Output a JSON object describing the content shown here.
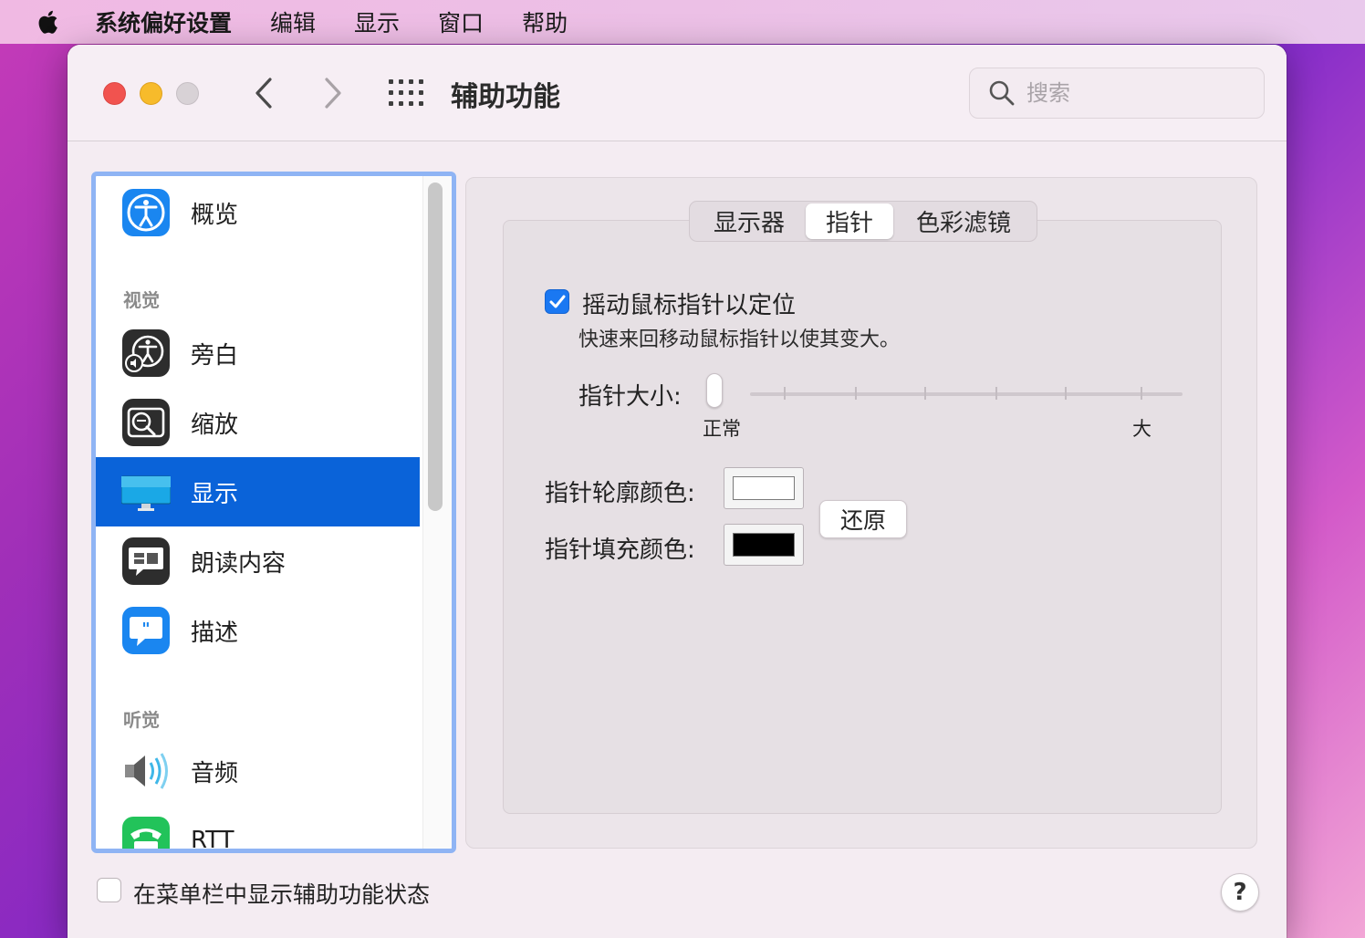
{
  "menubar": {
    "items": [
      "系统偏好设置",
      "编辑",
      "显示",
      "窗口",
      "帮助"
    ]
  },
  "window": {
    "title": "辅助功能",
    "search_placeholder": "搜索"
  },
  "sidebar": {
    "overview": "概览",
    "section_vision": "视觉",
    "items_vision": [
      "旁白",
      "缩放",
      "显示",
      "朗读内容",
      "描述"
    ],
    "section_hearing": "听觉",
    "items_hearing": [
      "音频",
      "RTT"
    ],
    "selected": "显示"
  },
  "tabs": [
    "显示器",
    "指针",
    "色彩滤镜"
  ],
  "active_tab": "指针",
  "pointer": {
    "shake_label": "摇动鼠标指针以定位",
    "shake_desc": "快速来回移动鼠标指针以使其变大。",
    "shake_checked": true,
    "size_label": "指针大小:",
    "size_min": "正常",
    "size_max": "大",
    "size_value": 0,
    "outline_label": "指针轮廓颜色:",
    "outline_color": "#ffffff",
    "fill_label": "指针填充颜色:",
    "fill_color": "#000000",
    "reset_label": "还原"
  },
  "footer": {
    "menubar_status_label": "在菜单栏中显示辅助功能状态",
    "menubar_status_checked": false,
    "help_label": "?"
  }
}
